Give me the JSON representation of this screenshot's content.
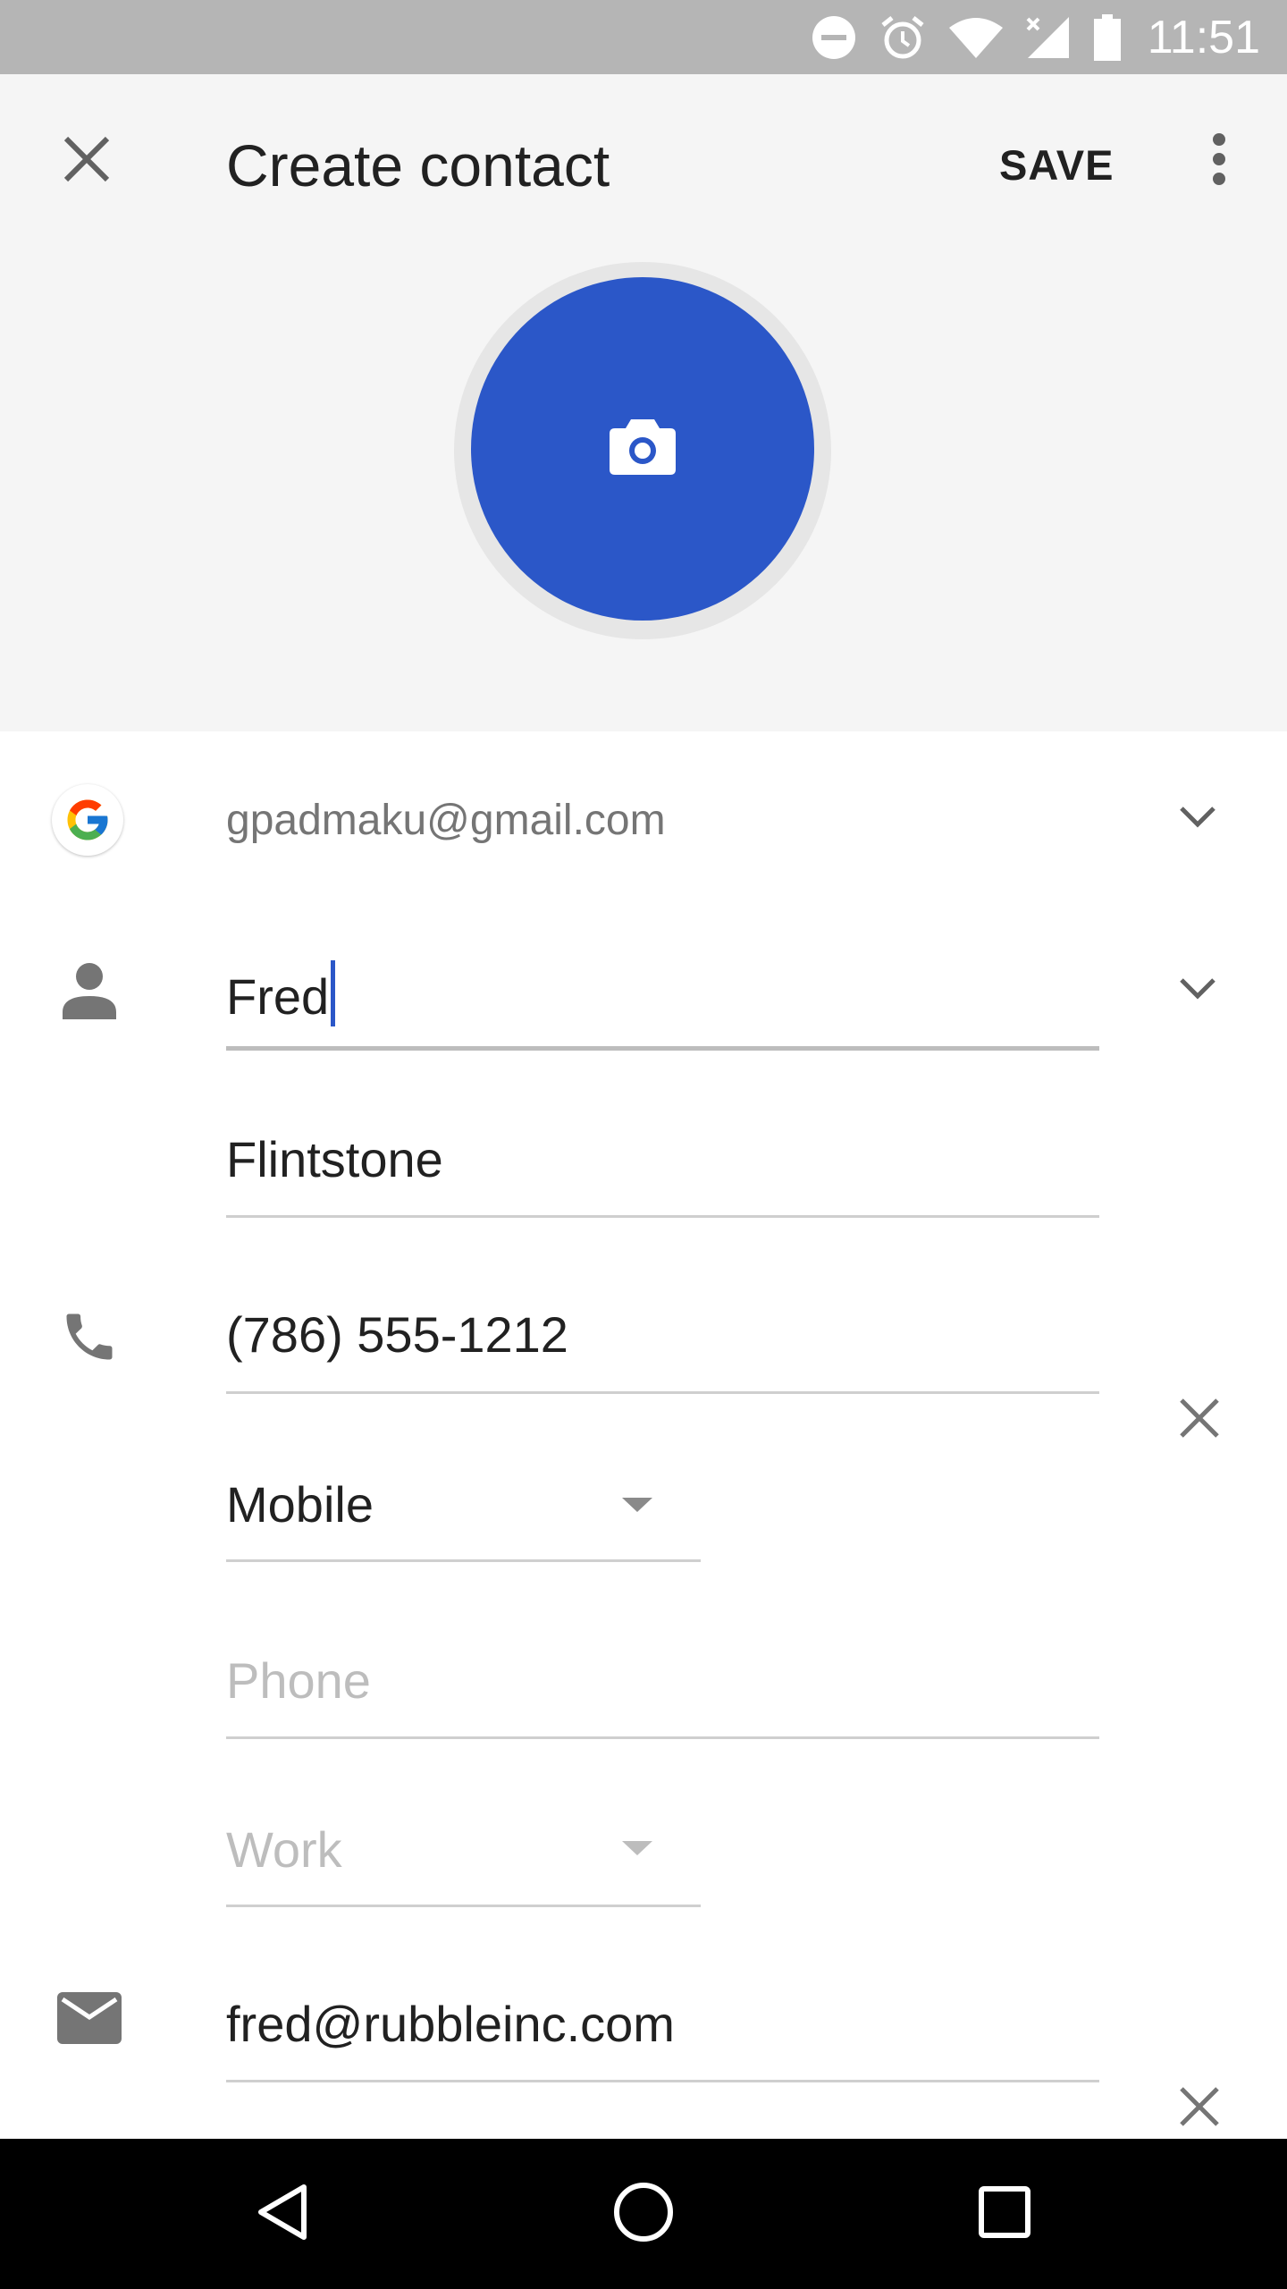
{
  "status_bar": {
    "time": "11:51",
    "icons": [
      "do-not-disturb-icon",
      "alarm-icon",
      "wifi-icon",
      "signal-no-data-icon",
      "battery-icon"
    ]
  },
  "app_bar": {
    "title": "Create contact",
    "save_label": "SAVE",
    "close_icon": "close-icon",
    "overflow_icon": "more-vert-icon"
  },
  "photo": {
    "icon": "camera-icon",
    "color": "#2b57c8"
  },
  "account": {
    "email": "gpadmaku@gmail.com",
    "icon": "google-icon"
  },
  "name": {
    "first_name": "Fred",
    "last_name": "Flintstone"
  },
  "phones": [
    {
      "number": "(786) 555-1212",
      "type": "Mobile"
    },
    {
      "number": "",
      "placeholder": "Phone",
      "type": "Work"
    }
  ],
  "email": {
    "value": "fred@rubbleinc.com"
  },
  "colors": {
    "accent": "#2b57c8",
    "status_bar": "#b5b5b5",
    "header_bg": "#f5f5f5"
  }
}
